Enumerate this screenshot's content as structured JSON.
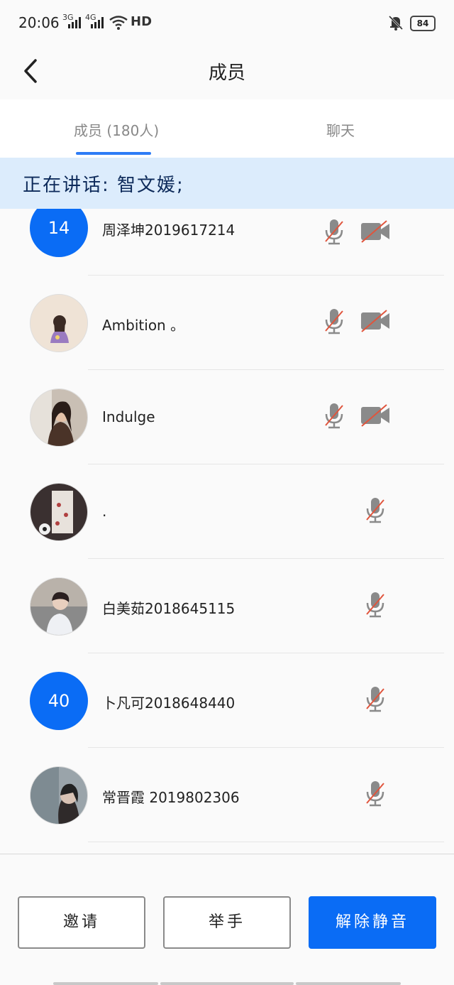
{
  "status_bar": {
    "time": "20:06",
    "net1": "3G",
    "net2": "4G",
    "wifi_label": "HD",
    "battery": "84"
  },
  "header": {
    "title": "成员"
  },
  "tabs": [
    {
      "label": "成员 (180人)"
    },
    {
      "label": "聊天"
    }
  ],
  "speaking_banner": "正在讲话: 智文媛;",
  "members": [
    {
      "name": "周泽坤2019617214",
      "avatar_text": "14",
      "mic": "muted",
      "camera": "off"
    },
    {
      "name": "Ambition 。",
      "avatar": "photo",
      "mic": "muted",
      "camera": "off"
    },
    {
      "name": "Indulge",
      "avatar": "photo",
      "mic": "muted",
      "camera": "off"
    },
    {
      "name": ".",
      "avatar": "photo",
      "mic": "muted"
    },
    {
      "name": "白美茹2018645115",
      "avatar": "photo",
      "mic": "muted"
    },
    {
      "name": "卜凡可2018648440",
      "avatar_text": "40",
      "mic": "muted"
    },
    {
      "name": "常晋霞 2019802306",
      "avatar": "photo",
      "mic": "muted"
    }
  ],
  "buttons": {
    "invite": "邀请",
    "raise_hand": "举手",
    "unmute": "解除静音"
  },
  "colors": {
    "accent": "#0a6cf5",
    "banner_bg": "#dcecfc",
    "mute_slash": "#e0543c",
    "icon_gray": "#8a8a8a"
  }
}
